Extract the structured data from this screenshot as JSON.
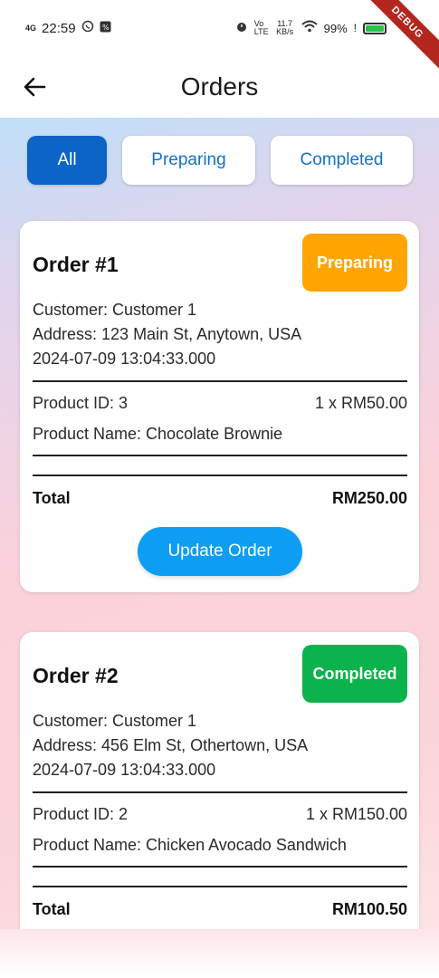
{
  "status_bar": {
    "network": "4G",
    "time": "22:59",
    "data_speed": "11.7 KB/s",
    "battery": "99%"
  },
  "debug_banner": "DEBUG",
  "app_bar": {
    "title": "Orders",
    "back_icon": "arrow-left-icon"
  },
  "filters": [
    {
      "label": "All",
      "active": true
    },
    {
      "label": "Preparing",
      "active": false
    },
    {
      "label": "Completed",
      "active": false
    }
  ],
  "orders": [
    {
      "title": "Order #1",
      "status": "Preparing",
      "status_color": "#fea501",
      "customer": "Customer: Customer 1",
      "address": "Address: 123 Main St, Anytown, USA",
      "date": "2024-07-09 13:04:33.000",
      "product_id": "Product ID: 3",
      "qty_price": "1 x RM50.00",
      "product_name": "Product Name: Chocolate Brownie",
      "total_label": "Total",
      "total_value": "RM250.00",
      "action_label": "Update Order"
    },
    {
      "title": "Order #2",
      "status": "Completed",
      "status_color": "#0cb24b",
      "customer": "Customer: Customer 1",
      "address": "Address: 456 Elm St, Othertown, USA",
      "date": "2024-07-09 13:04:33.000",
      "product_id": "Product ID: 2",
      "qty_price": "1 x RM150.00",
      "product_name": "Product Name: Chicken Avocado Sandwich",
      "total_label": "Total",
      "total_value": "RM100.50"
    }
  ]
}
